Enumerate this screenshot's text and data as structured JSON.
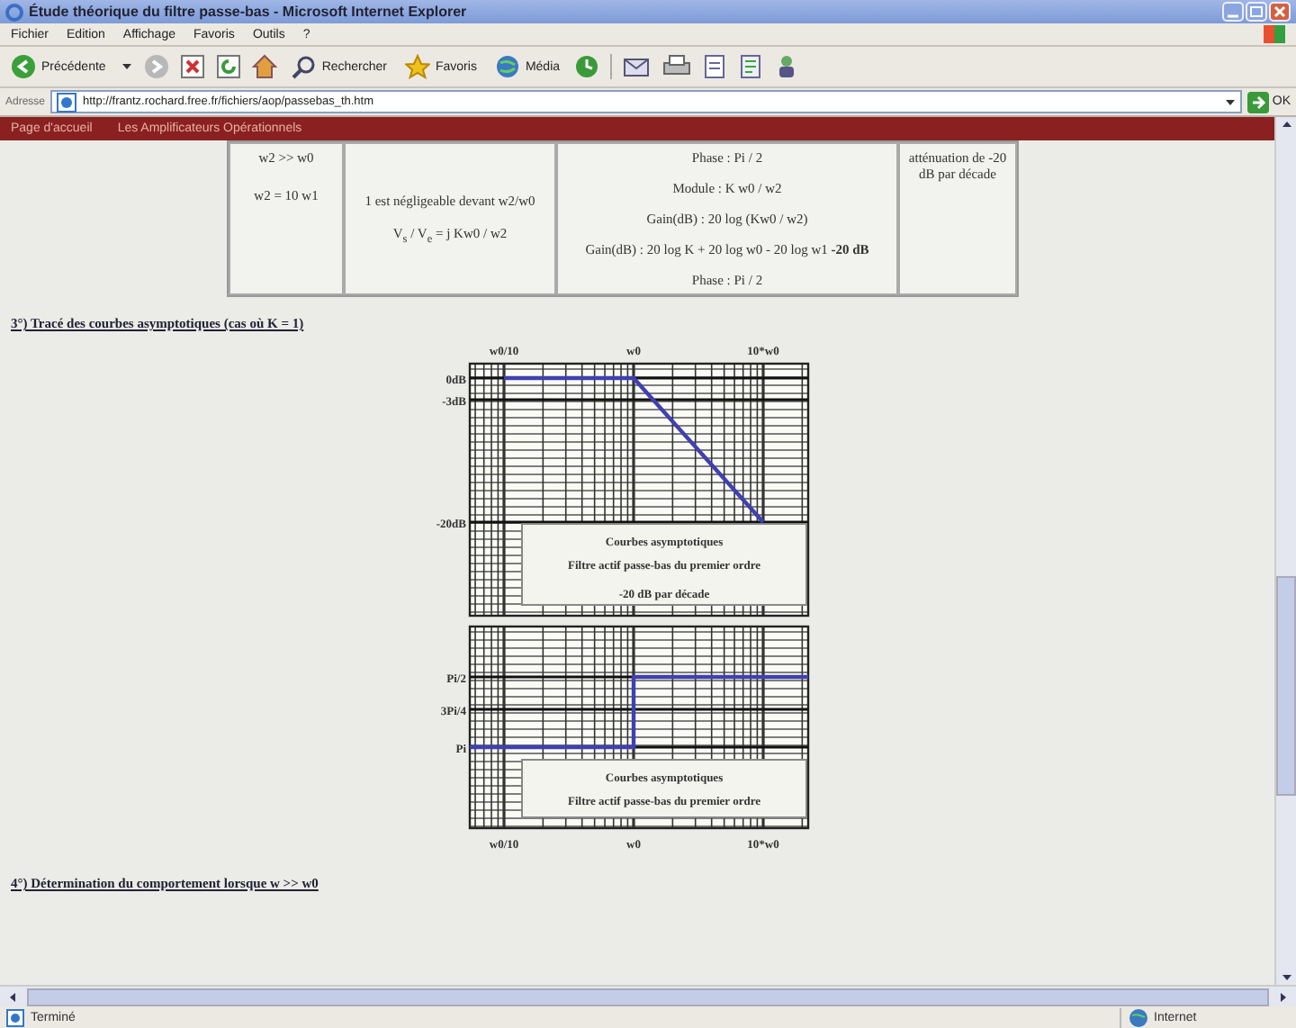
{
  "window": {
    "title": "Étude théorique du filtre passe-bas - Microsoft Internet Explorer"
  },
  "menu": [
    "Fichier",
    "Edition",
    "Affichage",
    "Favoris",
    "Outils",
    "?"
  ],
  "toolbar": {
    "back": "Précédente",
    "search": "Rechercher",
    "favorites": "Favoris",
    "media": "Média"
  },
  "address_bar": {
    "label": "Adresse",
    "value": "http://frantz.rochard.free.fr/fichiers/aop/passebas_th.htm",
    "go": "OK"
  },
  "site_nav": [
    "Page d'accueil",
    "Les Amplificateurs Opérationnels"
  ],
  "table": {
    "cells": [
      {
        "lines": [
          "w2 >> w0",
          "w2 = 10 w1"
        ]
      },
      {
        "lines": [
          "1 est négligeable devant w2/w0",
          "V$_{s}$ / V$_{e}$ = j Kw0 / w2"
        ]
      },
      {
        "lines": [
          "Phase : Pi / 2",
          "Module : K w0 / w2",
          "Gain(dB) : 20 log (Kw0 / w2)",
          "Gain(dB) : 20 log K + 20 log w0 - 20 log w1 **-20 dB**",
          "Phase : Pi / 2"
        ]
      },
      {
        "lines": [
          "atténuation de -20 dB par décade"
        ]
      }
    ]
  },
  "heading_3": "3°) Tracé des courbes asymptotiques (cas où K = 1)",
  "charts": [
    {
      "legend": [
        "Courbes asymptotiques",
        "Filtre actif passe-bas du premier ordre",
        "-20 dB par décade"
      ],
      "chart_data": {
        "type": "line",
        "grid": true,
        "categories": [
          "w0/10",
          "w0",
          "10*w0"
        ],
        "ylim": [
          -33,
          2
        ],
        "yticks": [
          {
            "value": 0,
            "label": "0dB"
          },
          {
            "value": -3,
            "label": "-3dB"
          },
          {
            "value": -20,
            "label": "-20dB"
          }
        ],
        "series": [
          {
            "color": "#4040b0",
            "values": [
              0,
              0,
              -20
            ]
          }
        ]
      }
    }
  ],
  "phase_plot": {
    "x_labels": [
      "w0/10",
      "w0",
      "10*w0"
    ],
    "y_labels": [
      "Pi/2",
      "3Pi/4",
      "Pi"
    ],
    "legend": [
      "Courbes asymptotiques",
      "Filtre actif passe-bas du premier ordre"
    ]
  },
  "heading_4": "4°) Détermination du comportement lorsque w >> w0",
  "status_bar": {
    "text": "Terminé",
    "zone": "Internet"
  }
}
